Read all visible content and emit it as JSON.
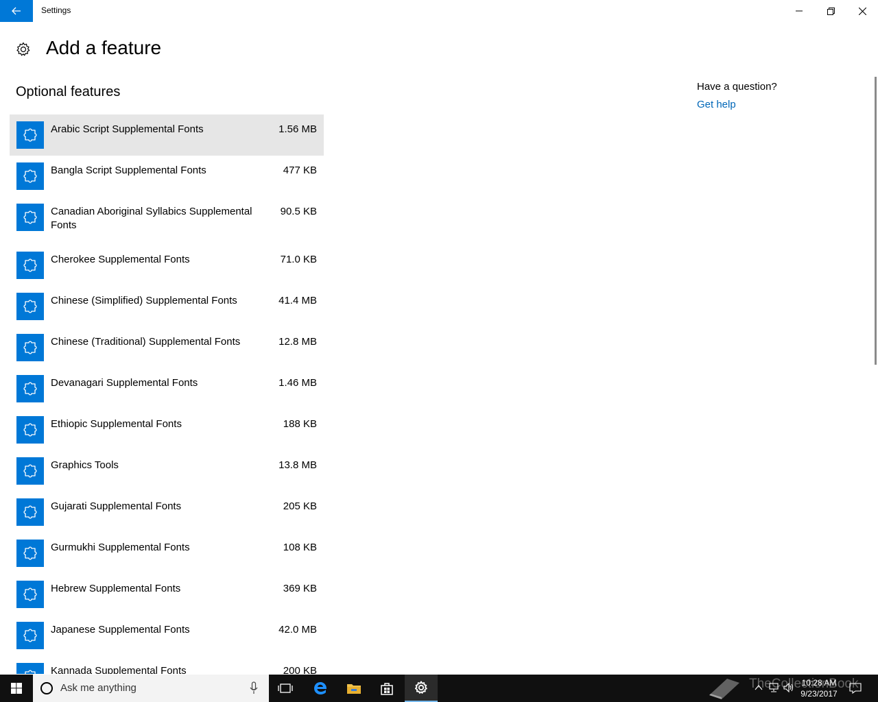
{
  "window": {
    "title": "Settings"
  },
  "page": {
    "title": "Add a feature"
  },
  "section": {
    "title": "Optional features"
  },
  "features": [
    {
      "name": "Arabic Script Supplemental Fonts",
      "size": "1.56 MB"
    },
    {
      "name": "Bangla Script Supplemental Fonts",
      "size": "477 KB"
    },
    {
      "name": "Canadian Aboriginal Syllabics Supplemental Fonts",
      "size": "90.5 KB"
    },
    {
      "name": "Cherokee Supplemental Fonts",
      "size": "71.0 KB"
    },
    {
      "name": "Chinese (Simplified) Supplemental Fonts",
      "size": "41.4 MB"
    },
    {
      "name": "Chinese (Traditional) Supplemental Fonts",
      "size": "12.8 MB"
    },
    {
      "name": "Devanagari Supplemental Fonts",
      "size": "1.46 MB"
    },
    {
      "name": "Ethiopic Supplemental Fonts",
      "size": "188 KB"
    },
    {
      "name": "Graphics Tools",
      "size": "13.8 MB"
    },
    {
      "name": "Gujarati Supplemental Fonts",
      "size": "205 KB"
    },
    {
      "name": "Gurmukhi Supplemental Fonts",
      "size": "108 KB"
    },
    {
      "name": "Hebrew Supplemental Fonts",
      "size": "369 KB"
    },
    {
      "name": "Japanese Supplemental Fonts",
      "size": "42.0 MB"
    },
    {
      "name": "Kannada Supplemental Fonts",
      "size": "200 KB"
    }
  ],
  "sidebar": {
    "question": "Have a question?",
    "help_link": "Get help"
  },
  "taskbar": {
    "search_placeholder": "Ask me anything",
    "time": "10:28 AM",
    "date": "9/23/2017",
    "watermark": "TheCollectionBook"
  },
  "colors": {
    "accent": "#0078d7",
    "link": "#0067b8",
    "selected_row": "#e6e6e6",
    "taskbar": "#101010"
  }
}
